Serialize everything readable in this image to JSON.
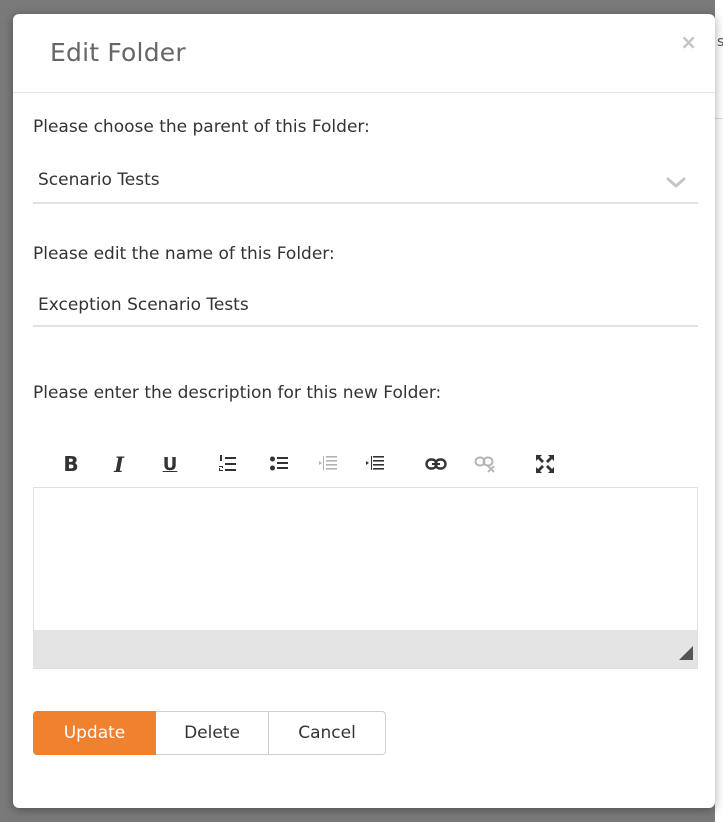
{
  "backdrop": {
    "partial_text": "s"
  },
  "dialog": {
    "title": "Edit Folder",
    "close_symbol": "×",
    "close_icon": "close-icon"
  },
  "parent_field": {
    "label": "Please choose the parent of this Folder:",
    "selected_value": "Scenario Tests",
    "icon": "chevron-down-icon"
  },
  "name_field": {
    "label": "Please edit the name of this Folder:",
    "value": "Exception Scenario Tests"
  },
  "description_field": {
    "label": "Please enter the description for this new Folder:",
    "toolbar": {
      "bold": "B",
      "italic": "I",
      "underline": "U",
      "icons": [
        "bold-icon",
        "italic-icon",
        "underline-icon",
        "numbered-list-icon",
        "bulleted-list-icon",
        "outdent-icon",
        "indent-icon",
        "link-icon",
        "unlink-icon",
        "maximize-icon"
      ]
    },
    "value": ""
  },
  "buttons": {
    "update": "Update",
    "delete": "Delete",
    "cancel": "Cancel"
  },
  "colors": {
    "accent": "#f0812f",
    "text": "#333333",
    "title": "#666666",
    "disabled_icon": "#b3b3b3"
  }
}
